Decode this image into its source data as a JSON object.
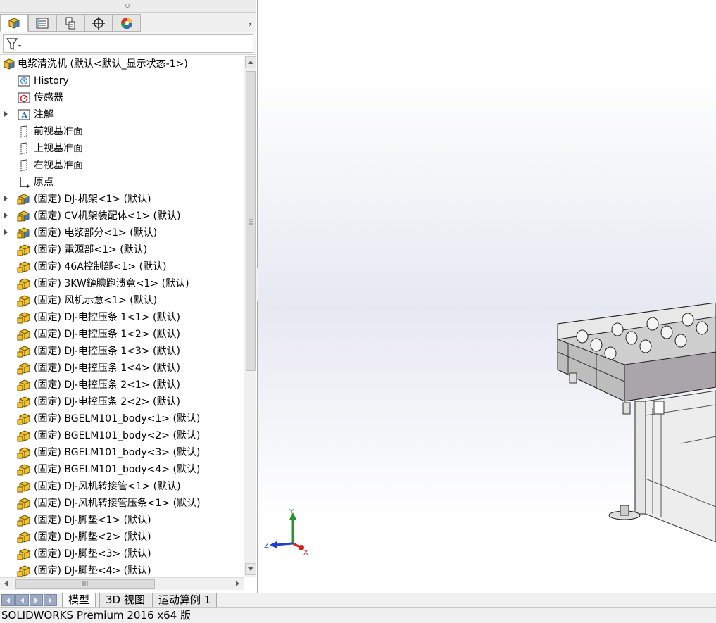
{
  "manager_tabs": [
    {
      "icon": "featuremanager-icon",
      "active": true
    },
    {
      "icon": "propertymanager-icon",
      "active": false
    },
    {
      "icon": "configurationmanager-icon",
      "active": false
    },
    {
      "icon": "dimxpertmanager-icon",
      "active": false
    },
    {
      "icon": "displaymanager-icon",
      "active": false
    }
  ],
  "filter": {
    "icon": "filter-icon"
  },
  "tree": {
    "root": "电浆清洗机  (默认<默认_显示状态-1>)",
    "items": [
      {
        "label": "History",
        "icon": "history-icon",
        "expander": false
      },
      {
        "label": "传感器",
        "icon": "sensor-icon",
        "expander": false
      },
      {
        "label": "注解",
        "icon": "annotation-icon",
        "expander": true
      },
      {
        "label": "前视基准面",
        "icon": "plane-icon",
        "expander": false
      },
      {
        "label": "上视基准面",
        "icon": "plane-icon",
        "expander": false
      },
      {
        "label": "右视基准面",
        "icon": "plane-icon",
        "expander": false
      },
      {
        "label": "原点",
        "icon": "origin-icon",
        "expander": false
      },
      {
        "label": "(固定) DJ-机架<1> (默认)",
        "icon": "subassembly-icon",
        "expander": true
      },
      {
        "label": "(固定) CV机架装配体<1> (默认)",
        "icon": "subassembly-icon",
        "expander": true
      },
      {
        "label": "(固定) 电浆部分<1> (默认)",
        "icon": "subassembly-icon",
        "expander": true
      },
      {
        "label": "(固定) 電源部<1> (默认)",
        "icon": "part-icon",
        "expander": false
      },
      {
        "label": "(固定) 46A控制部<1> (默认)",
        "icon": "part-icon",
        "expander": false
      },
      {
        "label": "(固定) 3KW鏈腆跑溃竟<1> (默认)",
        "icon": "part-icon",
        "expander": false
      },
      {
        "label": "(固定) 风机示意<1> (默认)",
        "icon": "part-icon",
        "expander": false
      },
      {
        "label": "(固定) DJ-电控压条 1<1> (默认)",
        "icon": "part-icon",
        "expander": false
      },
      {
        "label": "(固定) DJ-电控压条 1<2> (默认)",
        "icon": "part-icon",
        "expander": false
      },
      {
        "label": "(固定) DJ-电控压条 1<3> (默认)",
        "icon": "part-icon",
        "expander": false
      },
      {
        "label": "(固定) DJ-电控压条 1<4> (默认)",
        "icon": "part-icon",
        "expander": false
      },
      {
        "label": "(固定) DJ-电控压条 2<1> (默认)",
        "icon": "part-icon",
        "expander": false
      },
      {
        "label": "(固定) DJ-电控压条 2<2> (默认)",
        "icon": "part-icon",
        "expander": false
      },
      {
        "label": "(固定) BGELM101_body<1> (默认)",
        "icon": "part-icon",
        "expander": false
      },
      {
        "label": "(固定) BGELM101_body<2> (默认)",
        "icon": "part-icon",
        "expander": false
      },
      {
        "label": "(固定) BGELM101_body<3> (默认)",
        "icon": "part-icon",
        "expander": false
      },
      {
        "label": "(固定) BGELM101_body<4> (默认)",
        "icon": "part-icon",
        "expander": false
      },
      {
        "label": "(固定) DJ-风机转接管<1> (默认)",
        "icon": "part-icon",
        "expander": false
      },
      {
        "label": "(固定) DJ-风机转接管压条<1> (默认)",
        "icon": "part-icon",
        "expander": false
      },
      {
        "label": "(固定) DJ-脚垫<1> (默认)",
        "icon": "part-icon",
        "expander": false
      },
      {
        "label": "(固定) DJ-脚垫<2> (默认)",
        "icon": "part-icon",
        "expander": false
      },
      {
        "label": "(固定) DJ-脚垫<3> (默认)",
        "icon": "part-icon",
        "expander": false
      },
      {
        "label": "(固定) DJ-脚垫<4> (默认)",
        "icon": "part-icon",
        "expander": false
      }
    ]
  },
  "triad": {
    "x": "X",
    "y": "Y",
    "z": "Z"
  },
  "bottom_tabs": [
    {
      "label": "模型",
      "active": true
    },
    {
      "label": "3D 视图",
      "active": false
    },
    {
      "label": "运动算例 1",
      "active": false
    }
  ],
  "status": {
    "text": "SOLIDWORKS Premium 2016 x64 版"
  },
  "colors": {
    "accent_blue": "#2a6fc0",
    "part_yellow": "#f2c230",
    "axis_red": "#d42020",
    "axis_green": "#1f9a2a",
    "axis_blue": "#2040d0"
  }
}
